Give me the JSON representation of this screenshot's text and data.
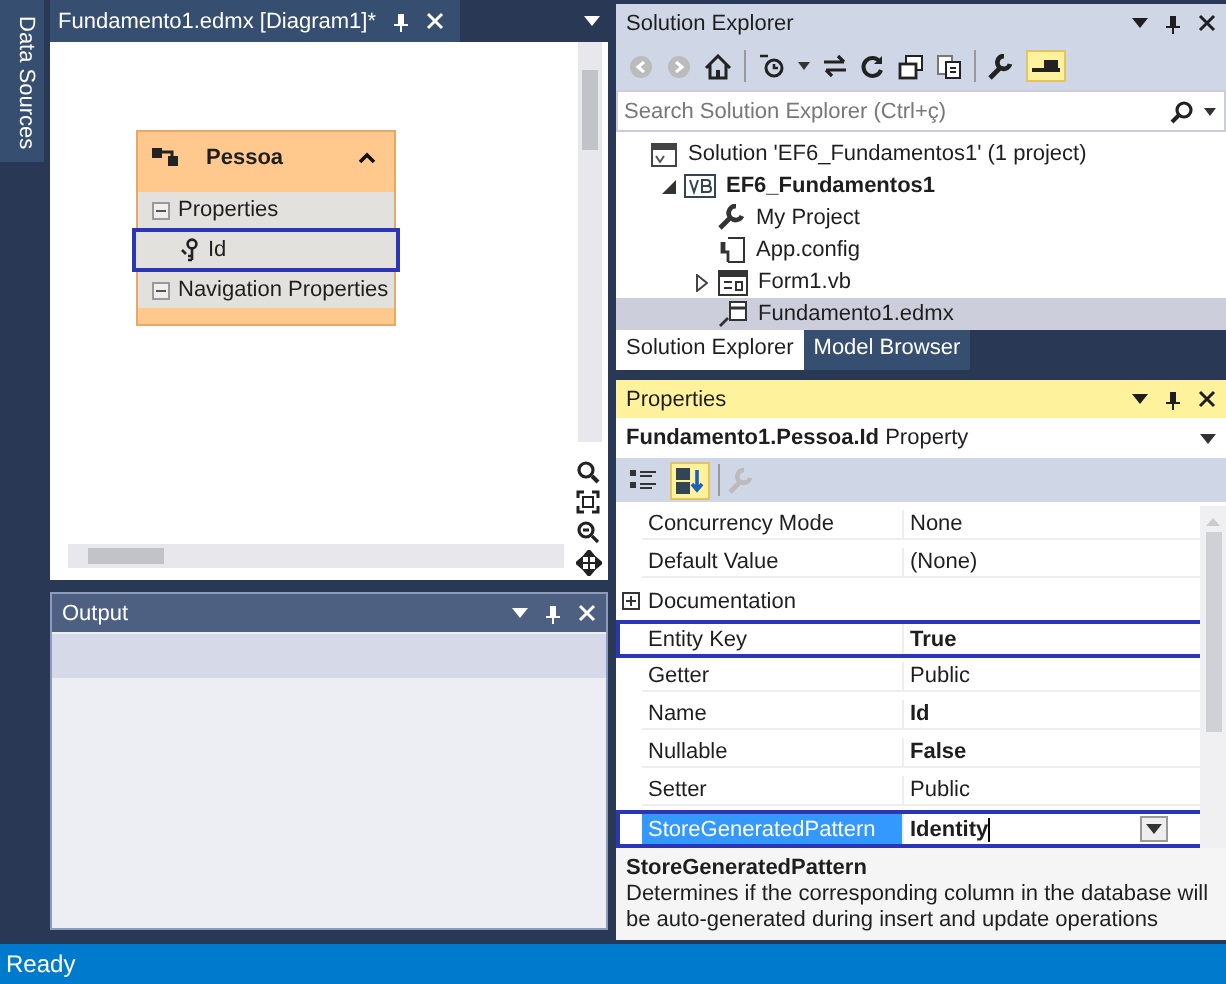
{
  "side_tab": {
    "label": "Data Sources"
  },
  "diagram": {
    "tab": {
      "title": "Fundamento1.edmx [Diagram1]*"
    },
    "entity": {
      "name": "Pessoa",
      "expanded": true,
      "sections": [
        {
          "label": "Properties",
          "expanded": true,
          "items": [
            {
              "name": "Id",
              "key": true,
              "highlighted": true
            }
          ]
        },
        {
          "label": "Navigation Properties",
          "expanded": true
        }
      ]
    }
  },
  "output": {
    "title": "Output"
  },
  "solution_explorer": {
    "title": "Solution Explorer",
    "search": {
      "placeholder": "Search Solution Explorer (Ctrl+ç)"
    },
    "tree": [
      {
        "label": "Solution 'EF6_Fundamentos1' (1 project)",
        "kind": "solution",
        "selected": false,
        "children": [
          {
            "label": "EF6_Fundamentos1",
            "kind": "project",
            "bold": true,
            "expanded": true,
            "selected": false,
            "children": [
              {
                "label": "My Project",
                "kind": "settings",
                "selected": false
              },
              {
                "label": "App.config",
                "kind": "config",
                "selected": false
              },
              {
                "label": "Form1.vb",
                "kind": "form",
                "expanded": false,
                "selected": false
              },
              {
                "label": "Fundamento1.edmx",
                "kind": "model",
                "selected": true
              }
            ]
          }
        ]
      }
    ],
    "tabs": [
      {
        "label": "Solution Explorer",
        "selected": true
      },
      {
        "label": "Model Browser",
        "selected": false
      }
    ]
  },
  "properties": {
    "title": "Properties",
    "object": {
      "name": "Fundamento1.Pessoa.Id",
      "type": "Property"
    },
    "sort_buttons": [
      {
        "kind": "categorized",
        "selected": false
      },
      {
        "kind": "alphabetical",
        "selected": true
      }
    ],
    "rows": [
      {
        "kind": "property",
        "name": "Concurrency Mode",
        "value": "None",
        "bold": false,
        "highlighted": false,
        "selected": false
      },
      {
        "kind": "property",
        "name": "Default Value",
        "value": "(None)",
        "bold": false,
        "highlighted": false,
        "selected": false
      },
      {
        "kind": "category",
        "name": "Documentation",
        "expanded": false
      },
      {
        "kind": "property",
        "name": "Entity Key",
        "value": "True",
        "bold": true,
        "highlighted": true,
        "selected": false
      },
      {
        "kind": "property",
        "name": "Getter",
        "value": "Public",
        "bold": false,
        "highlighted": false,
        "selected": false
      },
      {
        "kind": "property",
        "name": "Name",
        "value": "Id",
        "bold": true,
        "highlighted": false,
        "selected": false
      },
      {
        "kind": "property",
        "name": "Nullable",
        "value": "False",
        "bold": true,
        "highlighted": false,
        "selected": false
      },
      {
        "kind": "property",
        "name": "Setter",
        "value": "Public",
        "bold": false,
        "highlighted": false,
        "selected": false
      },
      {
        "kind": "property",
        "name": "StoreGeneratedPattern",
        "value": "Identity",
        "bold": true,
        "highlighted": true,
        "selected": true
      }
    ],
    "description": {
      "title": "StoreGeneratedPattern",
      "text": "Determines if the corresponding column in the database will be auto-generated during insert and update operations"
    }
  },
  "status_bar": {
    "text": "Ready"
  }
}
